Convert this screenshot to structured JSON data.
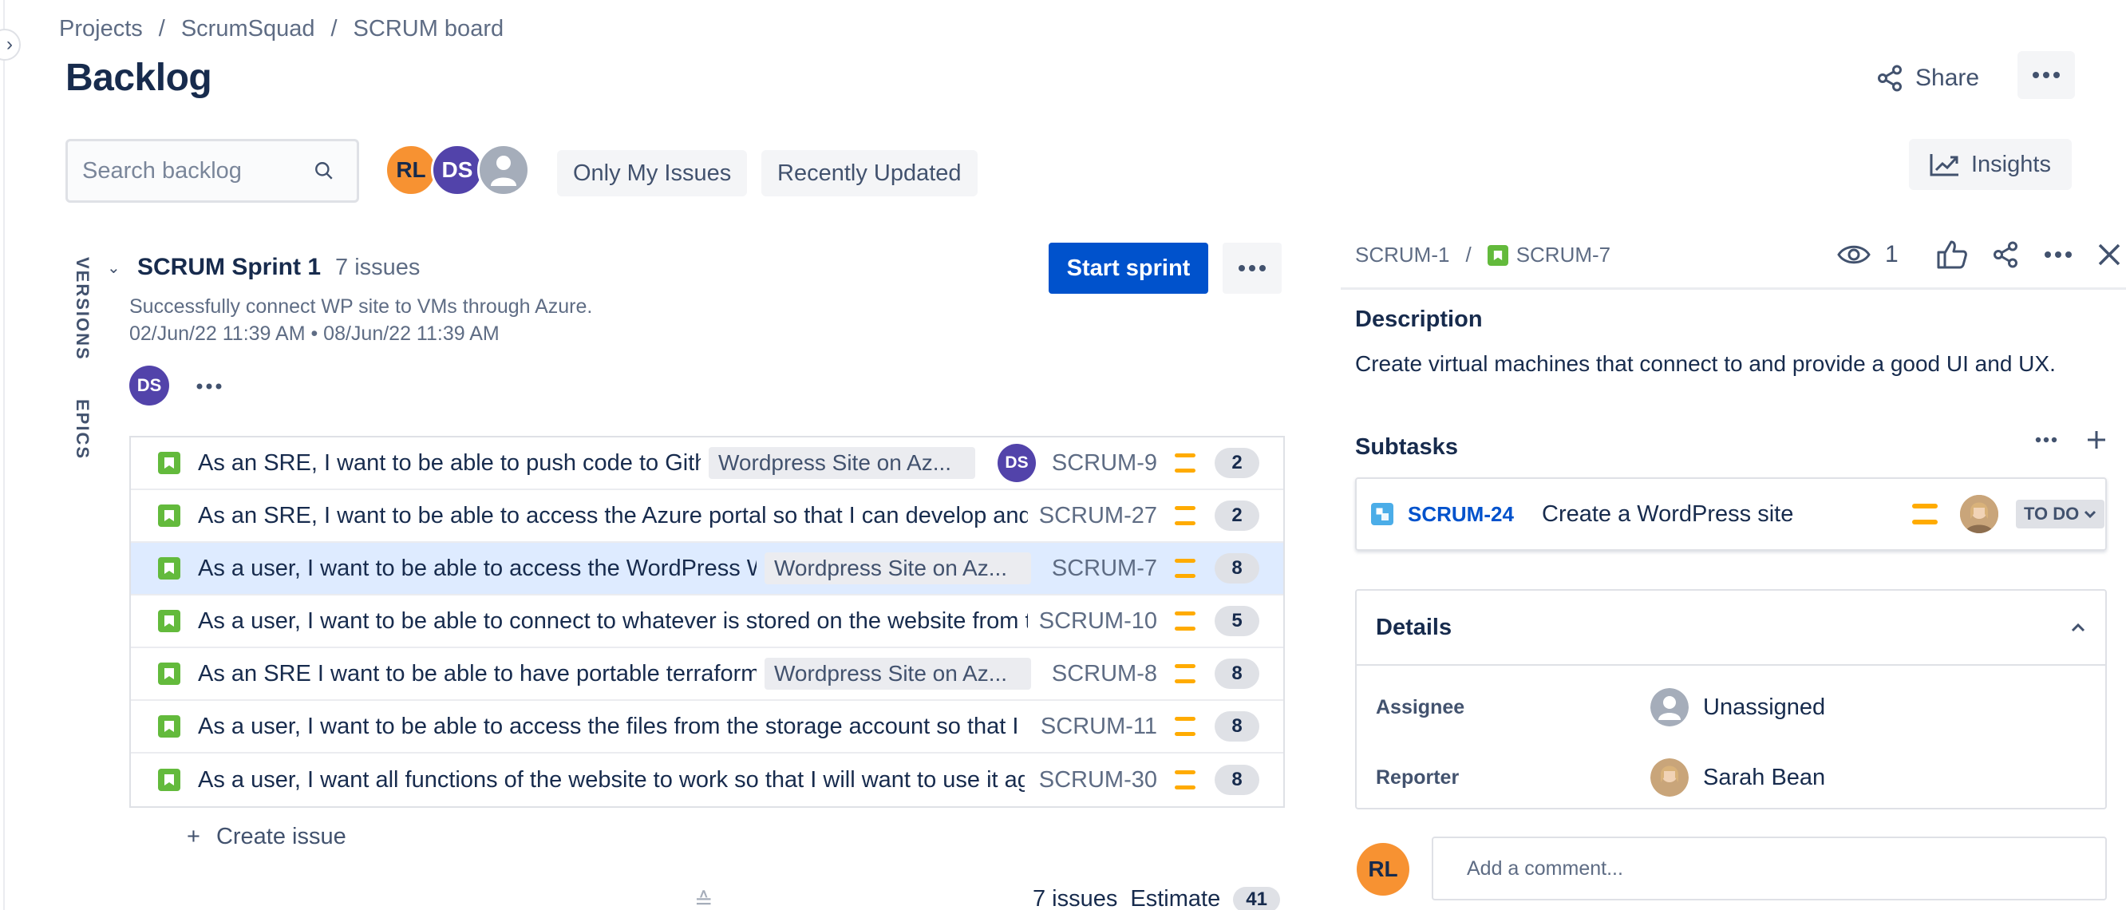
{
  "breadcrumb": [
    "Projects",
    "ScrumSquad",
    "SCRUM board"
  ],
  "page_title": "Backlog",
  "share_label": "Share",
  "search": {
    "placeholder": "Search backlog"
  },
  "avatars": [
    "RL",
    "DS"
  ],
  "filters": {
    "only_my_issues": "Only My Issues",
    "recently_updated": "Recently Updated"
  },
  "insights_label": "Insights",
  "side_tabs": {
    "versions": "VERSIONS",
    "epics": "EPICS"
  },
  "sprint": {
    "name": "SCRUM Sprint 1",
    "count": "7 issues",
    "goal": "Successfully connect WP site to VMs through Azure.",
    "dates": "02/Jun/22 11:39 AM  •  08/Jun/22 11:39 AM",
    "avatar": "DS",
    "start_label": "Start sprint"
  },
  "issues": [
    {
      "summary": "As an SRE, I want to be able to push code to Gith",
      "epic": "Wordpress Site on Az...",
      "assignee": "DS",
      "key": "SCRUM-9",
      "points": "2"
    },
    {
      "summary": "As an SRE, I want to be able to access the Azure portal so that I can develop and",
      "epic": "",
      "assignee": "",
      "key": "SCRUM-27",
      "points": "2"
    },
    {
      "summary": "As a user, I want to be able to access the WordPress W",
      "epic": "Wordpress Site on Az...",
      "assignee": "",
      "key": "SCRUM-7",
      "points": "8"
    },
    {
      "summary": "As a user, I want to be able to connect to whatever is stored on the website from t",
      "epic": "",
      "assignee": "",
      "key": "SCRUM-10",
      "points": "5"
    },
    {
      "summary": "As an SRE I want to be able to have portable terraform",
      "epic": "Wordpress Site on Az...",
      "assignee": "",
      "key": "SCRUM-8",
      "points": "8"
    },
    {
      "summary": "As a user, I want to be able to access the files from the storage account so that I c",
      "epic": "",
      "assignee": "",
      "key": "SCRUM-11",
      "points": "8"
    },
    {
      "summary": "As a user, I want all functions of the website to work so that I will want to use it ag",
      "epic": "",
      "assignee": "",
      "key": "SCRUM-30",
      "points": "8"
    }
  ],
  "create_issue_label": "Create issue",
  "footer": {
    "issues": "7 issues",
    "estimate_label": "Estimate",
    "estimate_value": "41"
  },
  "panel": {
    "parent_key": "SCRUM-1",
    "issue_key": "SCRUM-7",
    "watch_count": "1",
    "description_label": "Description",
    "description": "Create virtual machines that connect to and provide a good UI and UX.",
    "subtasks_label": "Subtasks",
    "subtask": {
      "key": "SCRUM-24",
      "summary": "Create a WordPress site",
      "status": "TO DO"
    },
    "details_label": "Details",
    "assignee_label": "Assignee",
    "assignee_value": "Unassigned",
    "reporter_label": "Reporter",
    "reporter_value": "Sarah Bean",
    "comment_avatar": "RL",
    "comment_placeholder": "Add a comment..."
  },
  "colors": {
    "primary": "#0052cc",
    "story": "#63ba3c",
    "subtask": "#4bade8",
    "priority_medium": "#ffab00",
    "selected_row": "#deebff"
  }
}
